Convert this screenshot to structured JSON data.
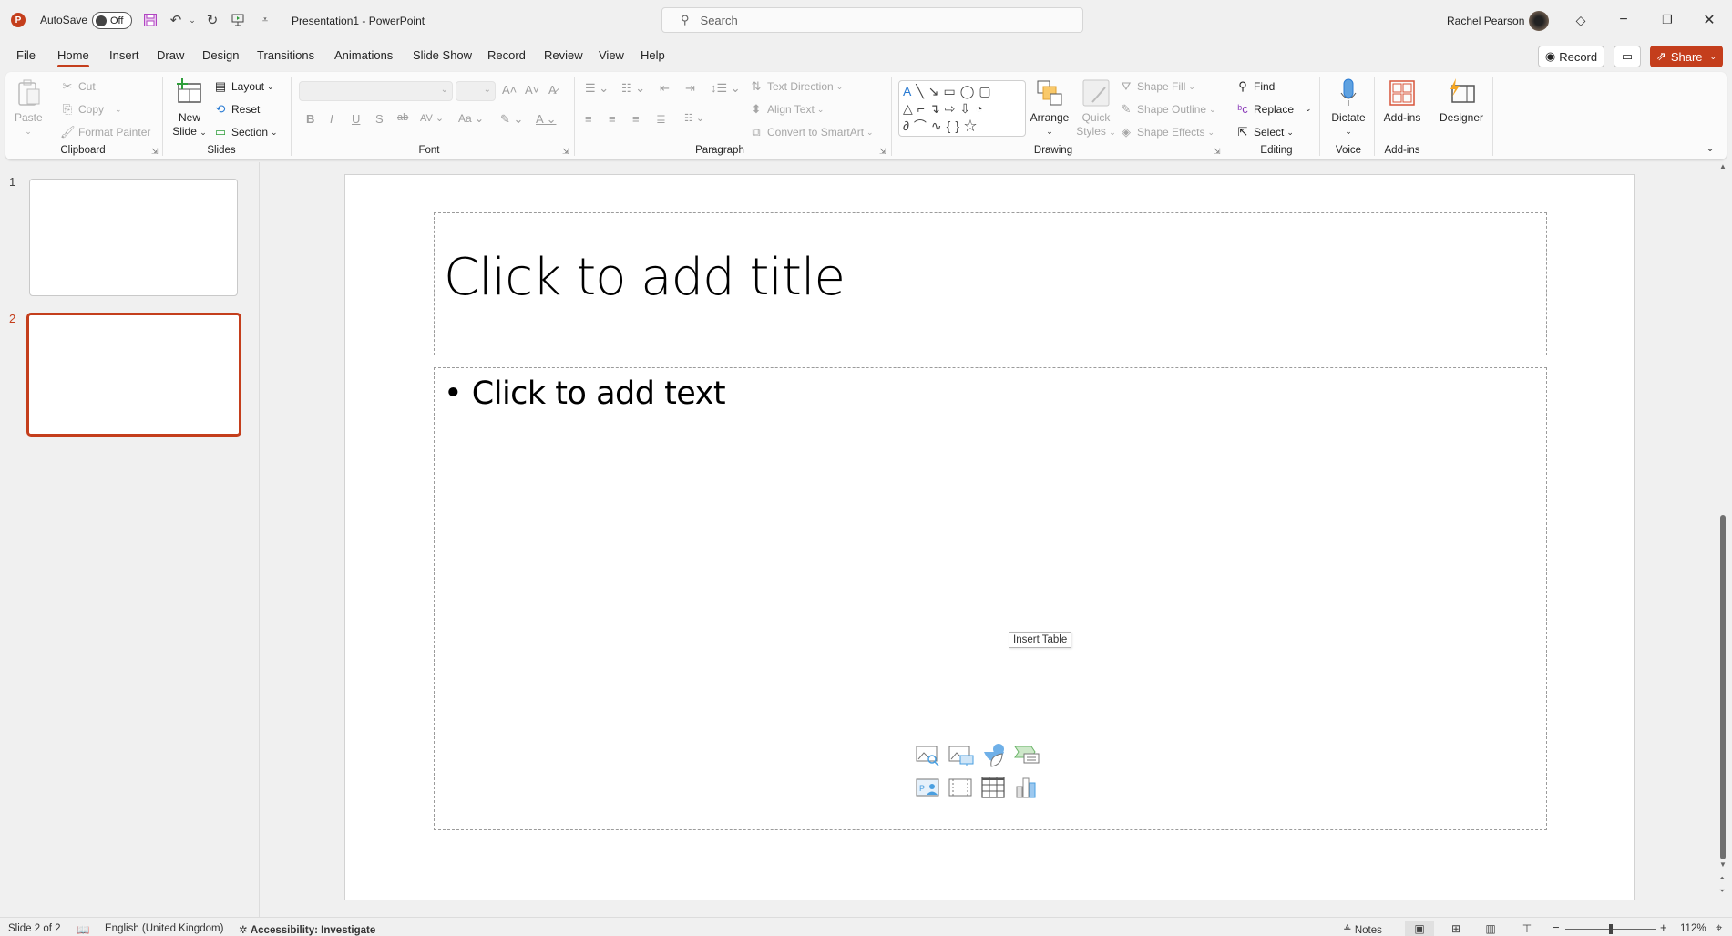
{
  "titlebar": {
    "app_logo": "P",
    "autosave_label": "AutoSave",
    "autosave_state": "Off",
    "doc_title": "Presentation1  -  PowerPoint",
    "search_placeholder": "Search",
    "user_name": "Rachel Pearson",
    "qat_icons": [
      "save-icon",
      "undo-icon",
      "redo-icon",
      "start-from-beginning-icon",
      "customize-qat-icon"
    ]
  },
  "tabs": [
    {
      "label": "File"
    },
    {
      "label": "Home",
      "active": true
    },
    {
      "label": "Insert"
    },
    {
      "label": "Draw"
    },
    {
      "label": "Design"
    },
    {
      "label": "Transitions"
    },
    {
      "label": "Animations"
    },
    {
      "label": "Slide Show"
    },
    {
      "label": "Record"
    },
    {
      "label": "Review"
    },
    {
      "label": "View"
    },
    {
      "label": "Help"
    }
  ],
  "header_buttons": {
    "record": "Record",
    "share": "Share"
  },
  "ribbon": {
    "clipboard": {
      "label": "Clipboard",
      "paste": "Paste",
      "cut": "Cut",
      "copy": "Copy",
      "format_painter": "Format Painter"
    },
    "slides": {
      "label": "Slides",
      "new_slide_1": "New",
      "new_slide_2": "Slide",
      "layout": "Layout",
      "reset": "Reset",
      "section": "Section"
    },
    "font": {
      "label": "Font",
      "font_name": "",
      "font_size": ""
    },
    "paragraph": {
      "label": "Paragraph",
      "text_direction": "Text Direction",
      "align_text": "Align Text",
      "convert_smartart": "Convert to SmartArt"
    },
    "drawing": {
      "label": "Drawing",
      "arrange": "Arrange",
      "quick_styles_1": "Quick",
      "quick_styles_2": "Styles",
      "shape_fill": "Shape Fill",
      "shape_outline": "Shape Outline",
      "shape_effects": "Shape Effects"
    },
    "editing": {
      "label": "Editing",
      "find": "Find",
      "replace": "Replace",
      "select": "Select"
    },
    "voice": {
      "label": "Voice",
      "dictate": "Dictate"
    },
    "addins": {
      "label": "Add-ins",
      "addins": "Add-ins"
    },
    "designer": {
      "label": "Designer"
    }
  },
  "thumbnails": [
    {
      "number": "1",
      "selected": false
    },
    {
      "number": "2",
      "selected": true
    }
  ],
  "slide": {
    "title_placeholder": "Click to add title",
    "body_placeholder": "Click to add text",
    "insert_icons": [
      "stock-images-icon",
      "pictures-icon",
      "icons-insert-icon",
      "smartart-icon",
      "cameo-icon",
      "video-icon",
      "insert-table-icon",
      "chart-icon"
    ],
    "tooltip": "Insert Table"
  },
  "statusbar": {
    "slide_info": "Slide 2 of 2",
    "language": "English (United Kingdom)",
    "accessibility": "Accessibility: Investigate",
    "notes": "Notes",
    "zoom": "112%",
    "zoom_fraction": 0.5
  },
  "colors": {
    "accent": "#c43e1c"
  }
}
